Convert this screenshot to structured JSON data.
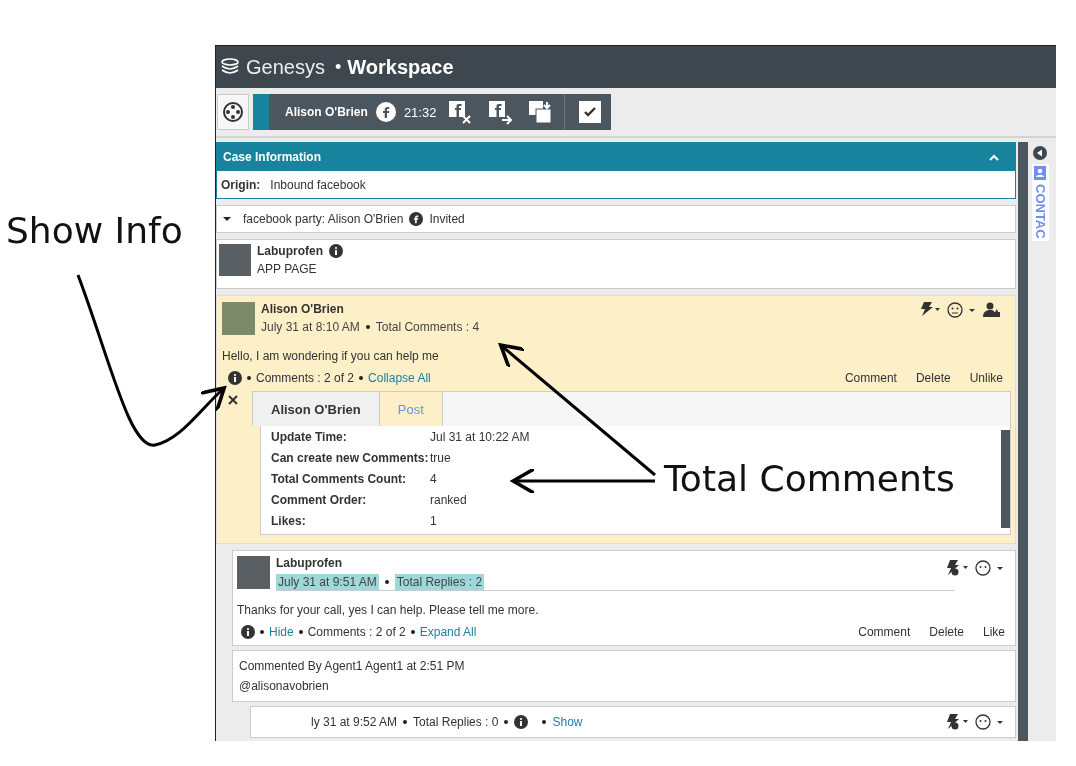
{
  "app": {
    "brand": "Genesys",
    "separator": "•",
    "product": "Workspace"
  },
  "interaction": {
    "contact": "Alison O'Brien",
    "timer": "21:32"
  },
  "case_info": {
    "title": "Case Information",
    "origin_label": "Origin:",
    "origin_value": "Inbound facebook"
  },
  "party": {
    "expanded": true,
    "text": "facebook party: Alison O'Brien",
    "status": "Invited"
  },
  "page_card": {
    "name": "Labuprofen",
    "subtitle": "APP PAGE"
  },
  "post": {
    "author": "Alison O'Brien",
    "time": "July 31 at 8:10 AM",
    "total": "Total Comments : 4",
    "message": "Hello, I am wondering if you can help me",
    "count": "Comments : 2 of 2",
    "toggle": "Collapse All",
    "actions": [
      "Comment",
      "Delete",
      "Unlike"
    ],
    "info_tabs": [
      {
        "label": "Alison O'Brien",
        "selected": false
      },
      {
        "label": "Post",
        "selected": true
      }
    ],
    "info_rows": [
      {
        "label": "Update Time:",
        "value": "Jul 31 at 10:22 AM"
      },
      {
        "label": "Can create new Comments:",
        "value": "true"
      },
      {
        "label": "Total Comments Count:",
        "value": "4"
      },
      {
        "label": "Comment Order:",
        "value": "ranked"
      },
      {
        "label": "Likes:",
        "value": "1"
      }
    ]
  },
  "comment": {
    "author": "Labuprofen",
    "time": "July 31 at 9:51 AM",
    "total": "Total Replies : 2",
    "highlighted": true,
    "message": "Thanks for your call, yes I can help. Please tell me more.",
    "hide": "Hide",
    "count": "Comments : 2 of 2",
    "toggle": "Expand All",
    "actions": [
      "Comment",
      "Delete",
      "Like"
    ]
  },
  "reply": {
    "text": "Commented By Agent1 Agent1 at 2:51 PM",
    "mention": "@alisonavobrien"
  },
  "sub_reply": {
    "time": "ly 31 at 9:52 AM",
    "total": "Total Replies : 0",
    "link": "Show"
  },
  "sidebar": {
    "tab_label": "CONTAC"
  },
  "annotations": [
    {
      "text": "Show Info"
    },
    {
      "text": "Total Comments"
    }
  ]
}
